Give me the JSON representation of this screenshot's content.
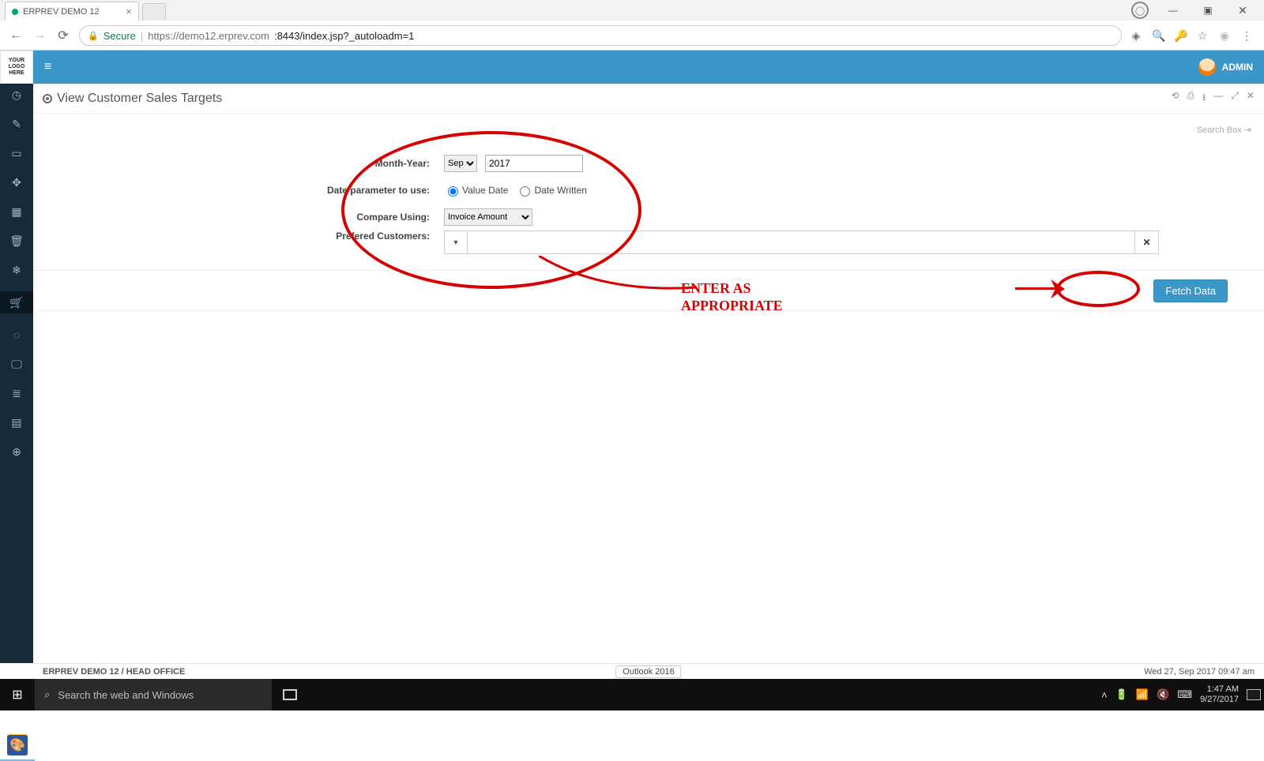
{
  "browser": {
    "tab_title": "ERPREV DEMO 12",
    "secure_label": "Secure",
    "url_host": "https://demo12.erprev.com",
    "url_port_path": ":8443/index.jsp?_autoloadm=1"
  },
  "header": {
    "logo_text": "YOUR LOGO HERE",
    "user_label": "ADMIN"
  },
  "page": {
    "title": "View Customer Sales Targets",
    "search_placeholder": "Search Box"
  },
  "sidebar": {
    "items": [
      {
        "icon": "gauge-icon"
      },
      {
        "icon": "tag-icon"
      },
      {
        "icon": "cash-icon"
      },
      {
        "icon": "link-icon"
      },
      {
        "icon": "box-icon"
      },
      {
        "icon": "trash-icon"
      },
      {
        "icon": "snow-icon"
      },
      {
        "icon": "cart-icon"
      },
      {
        "icon": "disc-icon"
      },
      {
        "icon": "monitor-icon"
      },
      {
        "icon": "db-icon"
      },
      {
        "icon": "book-icon"
      },
      {
        "icon": "globe-icon"
      }
    ],
    "active_index": 7
  },
  "form": {
    "month_label": "Month-Year:",
    "month_value": "Sep",
    "year_value": "2017",
    "date_param_label": "Date parameter to use:",
    "radio_value_date": "Value Date",
    "radio_date_written": "Date Written",
    "radio_selected": "Value Date",
    "compare_label": "Compare Using:",
    "compare_value": "Invoice Amount",
    "customers_label": "Prefered Customers:",
    "fetch_label": "Fetch Data"
  },
  "annotation": {
    "text_line1": "ENTER AS",
    "text_line2": "APPROPRIATE"
  },
  "footer": {
    "left": "ERPREV DEMO 12 / HEAD OFFICE",
    "center": "Outlook 2016",
    "right": "Wed 27, Sep 2017 09:47 am"
  },
  "taskbar": {
    "search_placeholder": "Search the web and Windows",
    "clock_time": "1:47 AM",
    "clock_date": "9/27/2017"
  }
}
